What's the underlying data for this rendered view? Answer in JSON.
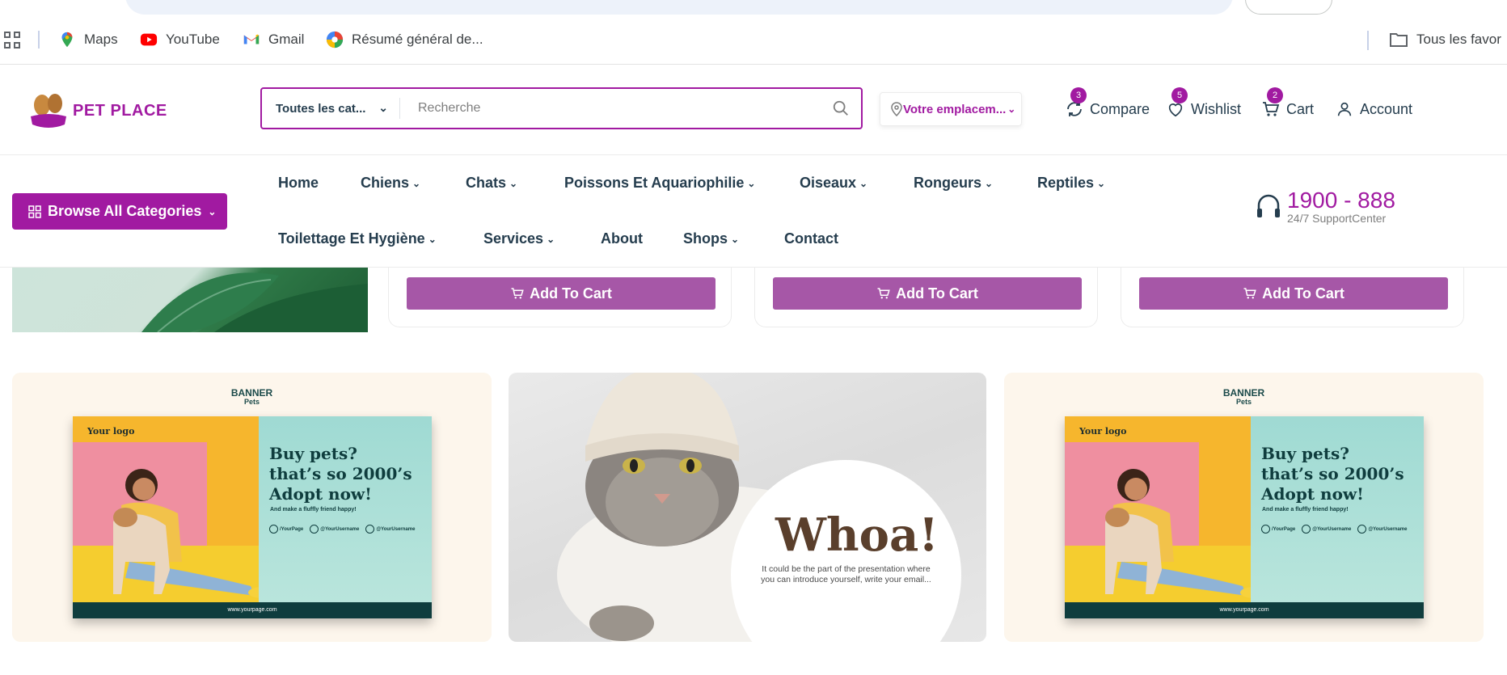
{
  "bookmarks": {
    "items": [
      {
        "label": "Maps",
        "icon": "maps-icon"
      },
      {
        "label": "YouTube",
        "icon": "youtube-icon"
      },
      {
        "label": "Gmail",
        "icon": "gmail-icon"
      },
      {
        "label": "Résumé général de...",
        "icon": "color-wheel-icon"
      }
    ],
    "all_bookmarks": "Tous les favor"
  },
  "header": {
    "logo_text": "PET PLACE",
    "search_category": "Toutes les cat...",
    "search_placeholder": "Recherche",
    "location": "Votre emplacem...",
    "actions": [
      {
        "label": "Compare",
        "badge": "3"
      },
      {
        "label": "Wishlist",
        "badge": "5"
      },
      {
        "label": "Cart",
        "badge": "2"
      },
      {
        "label": "Account"
      }
    ]
  },
  "nav": {
    "browse_label": "Browse All Categories",
    "items": [
      "Home",
      "Chiens",
      "Chats",
      "Poissons Et Aquariophilie",
      "Oiseaux",
      "Rongeurs",
      "Reptiles",
      "Toilettage Et Hygiène",
      "Services",
      "About",
      "Shops",
      "Contact"
    ],
    "support_number": "1900 - 888",
    "support_label": "24/7 SupportCenter"
  },
  "products": {
    "add_to_cart_label": "Add To Cart"
  },
  "banners": {
    "title": "BANNER",
    "subtitle": "Pets",
    "logo": "Your logo",
    "headline": [
      "Buy pets?",
      "that’s so 2000’s",
      "Adopt now!"
    ],
    "tagline": "And make a fluffly friend happy!",
    "social": [
      "/YourPage",
      "@YourUsername",
      "@YourUsername"
    ],
    "footer": "www.yourpage.com",
    "whoa_title": "Whoa!",
    "whoa_text": "It could be the part of the presentation where you can introduce yourself, write your email..."
  },
  "colors": {
    "brand": "#a11aa1",
    "button": "#a657a7",
    "text": "#253d4e"
  }
}
